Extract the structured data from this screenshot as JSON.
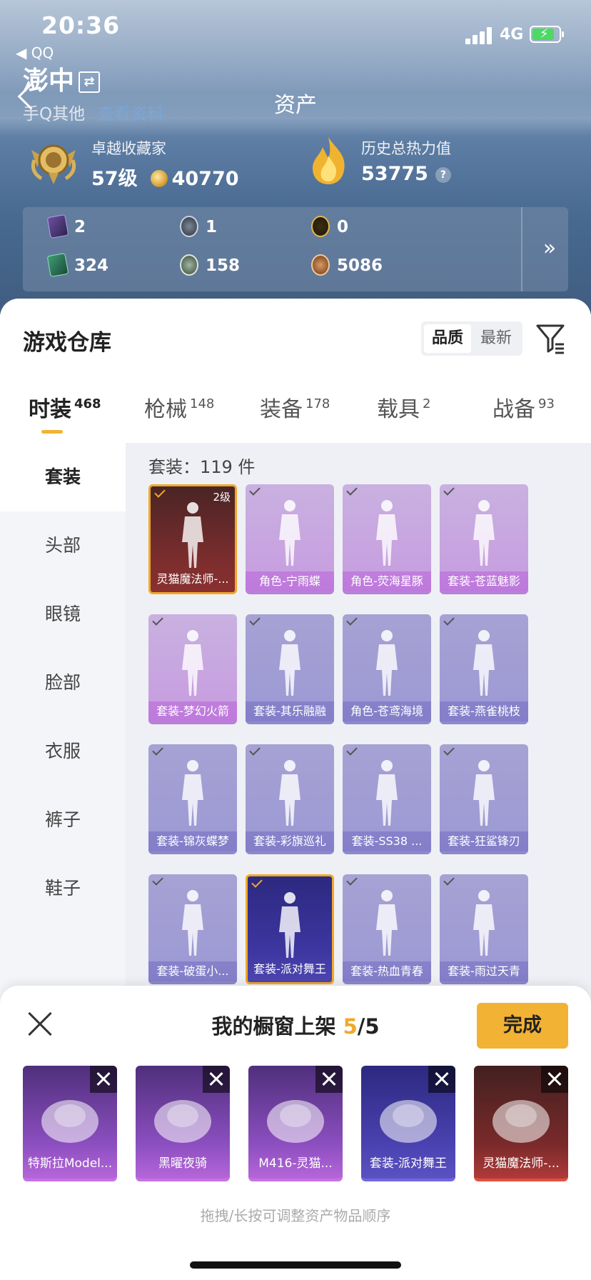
{
  "status_bar": {
    "time": "20:36",
    "back_app": "◀ QQ",
    "network": "4G"
  },
  "nav": {
    "user_name": "澎中",
    "swap_icon": "⇄",
    "sub_left": "手Q其他",
    "sub_hint": "查看资料",
    "title": "资产"
  },
  "stats": {
    "collector_label": "卓越收藏家",
    "collector_level": "57级",
    "collector_coins": "40770",
    "heat_label": "历史总热力值",
    "heat_value": "53775",
    "heat_help": "?"
  },
  "resources": [
    {
      "icon": "card-icon",
      "value": "2"
    },
    {
      "icon": "silver-token-icon",
      "value": "1"
    },
    {
      "icon": "gold-token-icon",
      "value": "0"
    },
    {
      "icon": "green-card-icon",
      "value": "324"
    },
    {
      "icon": "bronze-coin-icon",
      "value": "158"
    },
    {
      "icon": "copper-coin-icon",
      "value": "5086"
    }
  ],
  "resources_more": "»",
  "warehouse": {
    "title": "游戏仓库",
    "sort_options": [
      "品质",
      "最新"
    ],
    "sort_selected": "品质",
    "tabs": [
      {
        "label": "时装",
        "count": "468"
      },
      {
        "label": "枪械",
        "count": "148"
      },
      {
        "label": "装备",
        "count": "178"
      },
      {
        "label": "载具",
        "count": "2"
      },
      {
        "label": "战备",
        "count": "93"
      }
    ],
    "active_tab": "时装",
    "categories": [
      "套装",
      "头部",
      "眼镜",
      "脸部",
      "衣服",
      "裤子",
      "鞋子"
    ],
    "active_category": "套装",
    "count_label": "套装：119 件",
    "items": [
      {
        "name": "灵猫魔法师-...",
        "level": "2级",
        "style": "red",
        "selected": true
      },
      {
        "name": "角色-宁雨蝶",
        "style": "pink"
      },
      {
        "name": "角色-荧海星豚",
        "style": "pink"
      },
      {
        "name": "套装-苍蓝魅影",
        "style": "pink"
      },
      {
        "name": "套装-梦幻火箭",
        "style": "pink"
      },
      {
        "name": "套装-其乐融融",
        "style": "blue"
      },
      {
        "name": "角色-苍鸢海境",
        "style": "blue"
      },
      {
        "name": "套装-燕雀桃枝",
        "style": "blue"
      },
      {
        "name": "套装-锦灰蝶梦",
        "style": "blue"
      },
      {
        "name": "套装-彩旗巡礼",
        "style": "blue"
      },
      {
        "name": "套装-SS38 ...",
        "style": "blue"
      },
      {
        "name": "套装-狂鲨锋刃",
        "style": "blue"
      },
      {
        "name": "套装-破蛋小...",
        "style": "blue"
      },
      {
        "name": "套装-派对舞王",
        "style": "gold",
        "selected": true
      },
      {
        "name": "套装-热血青春",
        "style": "blue"
      },
      {
        "name": "套装-雨过天青",
        "style": "blue"
      }
    ]
  },
  "showcase": {
    "title_prefix": "我的橱窗上架 ",
    "current": "5",
    "total": "/5",
    "done_label": "完成",
    "slots": [
      {
        "name": "特斯拉Model...",
        "style": "purple"
      },
      {
        "name": "黑曜夜骑",
        "style": "purple"
      },
      {
        "name": "M416-灵猫...",
        "style": "purple"
      },
      {
        "name": "套装-派对舞王",
        "style": "gold"
      },
      {
        "name": "灵猫魔法师-...",
        "style": "red"
      }
    ],
    "hint": "拖拽/长按可调整资产物品顺序"
  }
}
